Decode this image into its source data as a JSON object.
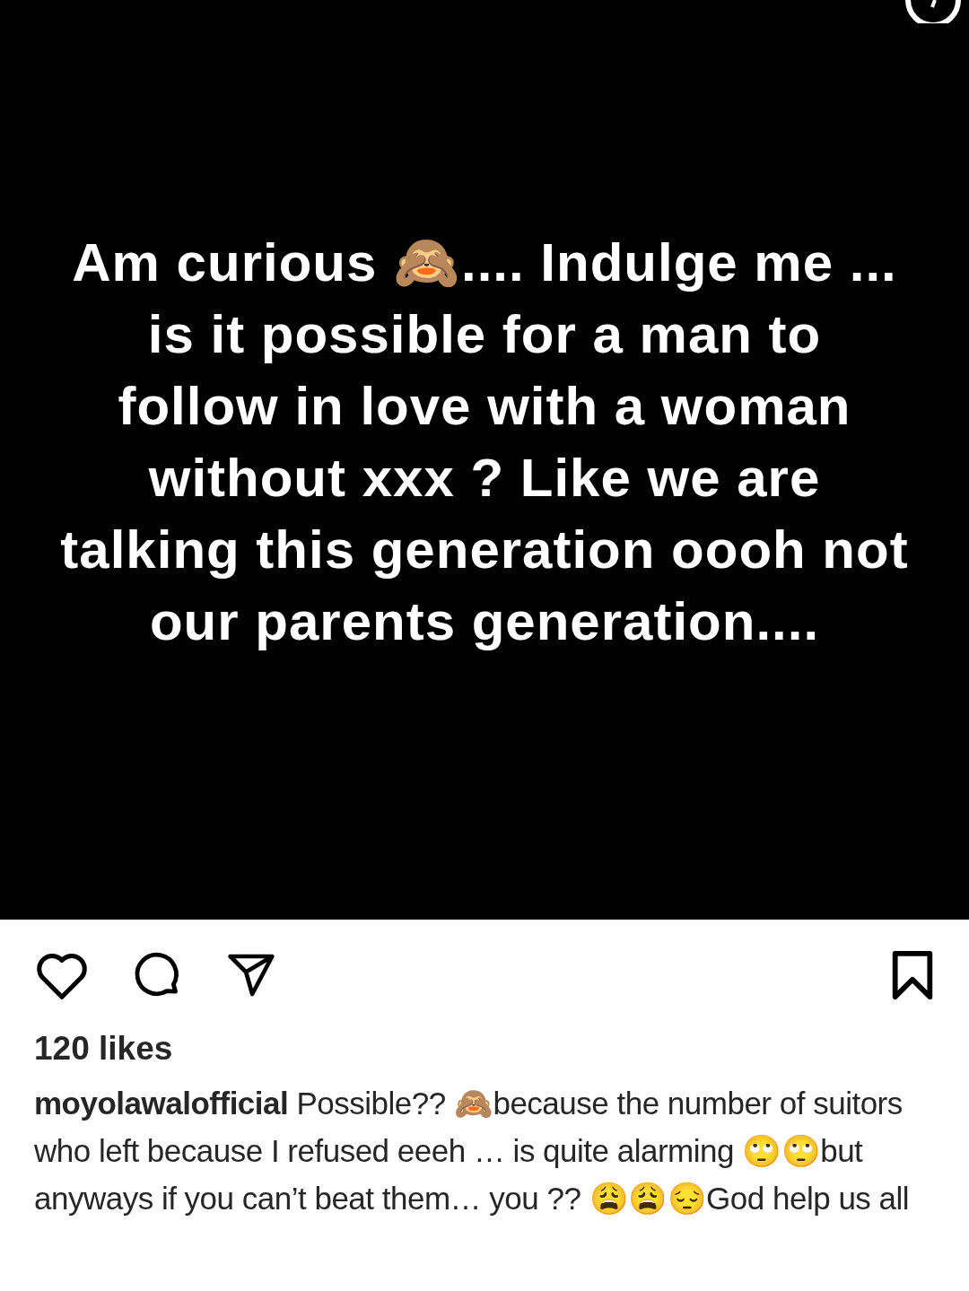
{
  "post_image": {
    "lines": [
      "Am curious 🙈.... Indulge me ...",
      "is it possible for a man to",
      "follow in love with a woman",
      "without xxx ? Like we are",
      "talking this generation oooh not",
      "our parents generation...."
    ]
  },
  "actions": {
    "liked": false,
    "saved": false
  },
  "likes": "120 likes",
  "caption": "**moyolawalofficial** Possible?? 🙈because the number of suitors who left because I refused eeeh … is quite alarming 🙄🙄but anyways if you can’t beat them… you ?? 😩😩😔God help us all"
}
